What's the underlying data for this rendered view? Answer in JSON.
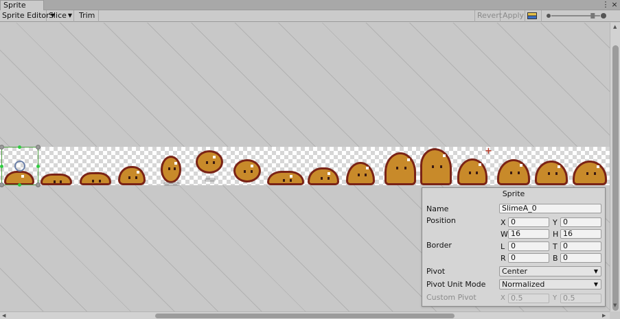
{
  "window": {
    "tab_title": "Sprite Editor",
    "menu_glyph": "⋮",
    "close_glyph": "×"
  },
  "toolbar": {
    "sprite_editor_dropdown": "Sprite Editor",
    "slice_dropdown": "Slice",
    "trim_button": "Trim",
    "revert_button": "Revert",
    "apply_button": "Apply",
    "dropdown_arrow": "▼",
    "zoom_level": 0.85
  },
  "canvas": {
    "sprite_count": 16,
    "selected_sprite_index": 0
  },
  "inspector": {
    "title": "Sprite",
    "name_label": "Name",
    "name_value": "SlimeA_0",
    "position_label": "Position",
    "x_label": "X",
    "x_value": "0",
    "y_label": "Y",
    "y_value": "0",
    "w_label": "W",
    "w_value": "16",
    "h_label": "H",
    "h_value": "16",
    "border_label": "Border",
    "l_label": "L",
    "l_value": "0",
    "t_label": "T",
    "t_value": "0",
    "r_label": "R",
    "r_value": "0",
    "b_label": "B",
    "b_value": "0",
    "pivot_label": "Pivot",
    "pivot_value": "Center",
    "pivot_unit_label": "Pivot Unit Mode",
    "pivot_unit_value": "Normalized",
    "custom_pivot_label": "Custom Pivot",
    "cp_x_label": "X",
    "cp_x_value": "0.5",
    "cp_y_label": "Y",
    "cp_y_value": "0.5"
  },
  "colors": {
    "slime_body": "#c88a2a",
    "slime_outline": "#7a2316",
    "selection_handle": "#2ecc40"
  }
}
